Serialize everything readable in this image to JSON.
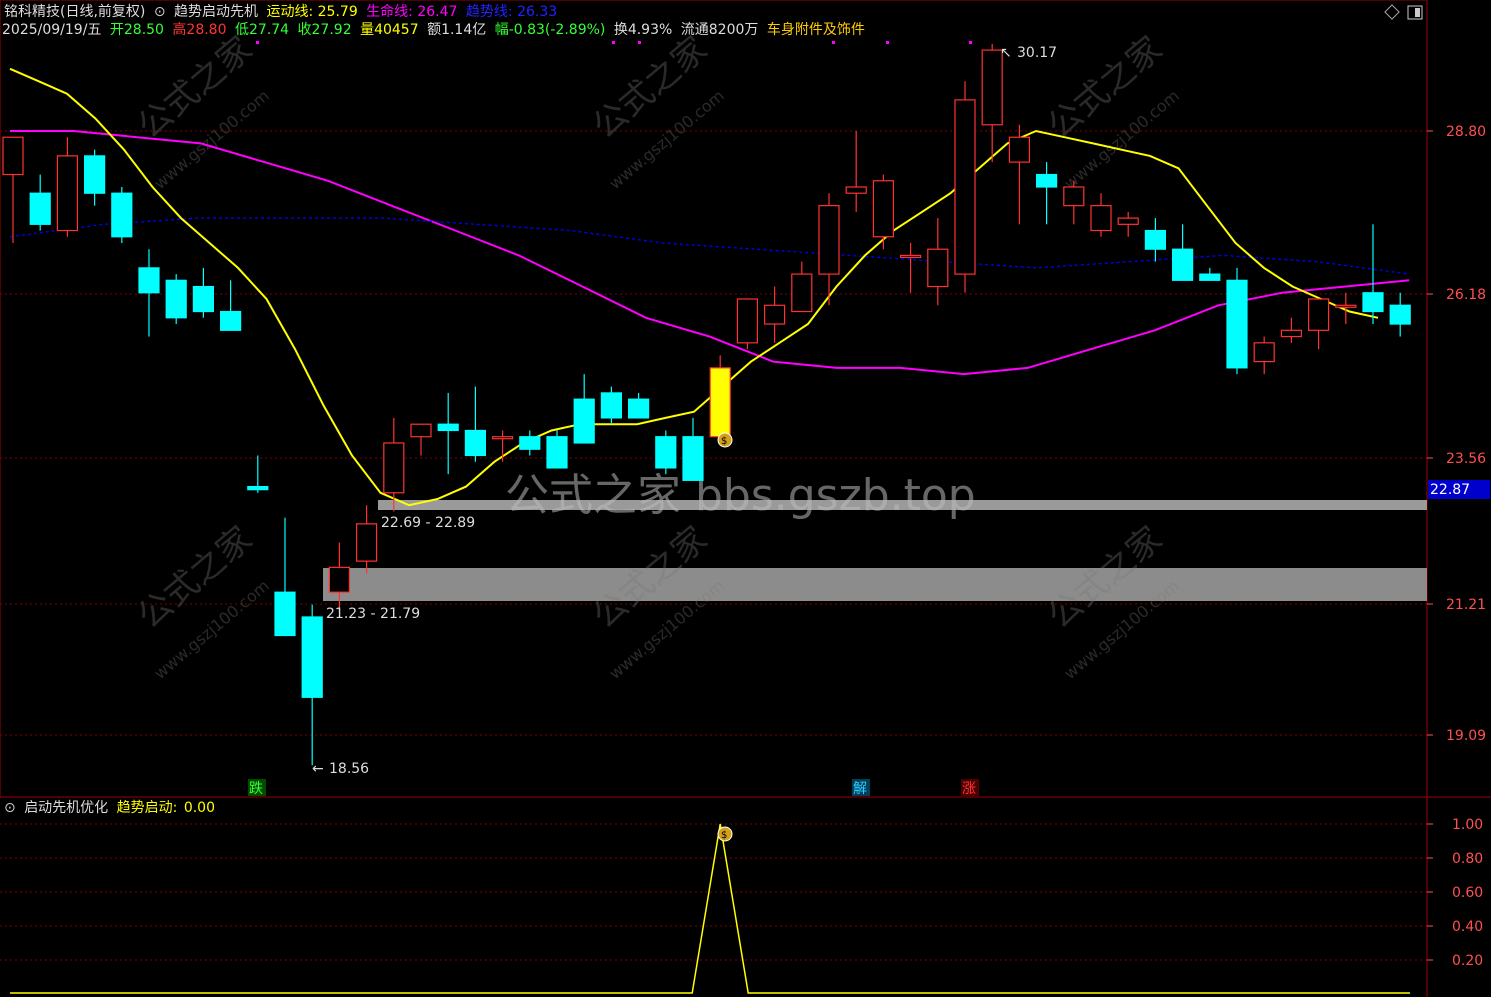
{
  "header": {
    "stock_title": "铭科精技(日线,前复权)",
    "indicator_name": "趋势启动先机",
    "yundong_label": "运动线:",
    "yundong_value": "25.79",
    "shengming_label": "生命线:",
    "shengming_value": "26.47",
    "qushi_label": "趋势线:",
    "qushi_value": "26.33",
    "date": "2025/09/19/五",
    "open_label": "开",
    "open_value": "28.50",
    "high_label": "高",
    "high_value": "28.80",
    "low_label": "低",
    "low_value": "27.74",
    "close_label": "收",
    "close_value": "27.92",
    "volume_label": "量",
    "volume_value": "40457",
    "amount_label": "额",
    "amount_value": "1.14亿",
    "change_label": "幅",
    "change_value": "-0.83(-2.89%)",
    "turnover_label": "换",
    "turnover_value": "4.93%",
    "float_label": "流通",
    "float_value": "8200万",
    "sector": "车身附件及饰件"
  },
  "price_axis": [
    "28.80",
    "26.18",
    "23.56",
    "21.21",
    "19.09"
  ],
  "current_price_tag": "22.87",
  "annotations": {
    "high_marker": "30.17",
    "low_marker": "18.56",
    "zone_upper_label": "22.69 - 22.89",
    "zone_lower_label": "21.23 - 21.79",
    "signal_die": "跌",
    "signal_jie": "解",
    "signal_zhang": "涨",
    "watermark_main": "公式之家 bbs.gszb.top",
    "watermark_small": "公式之家",
    "watermark_url": "www.gszj100.com"
  },
  "sub_panel": {
    "name": "启动先机优化",
    "signal_label": "趋势启动:",
    "signal_value": "0.00",
    "axis": [
      "1.00",
      "0.80",
      "0.60",
      "0.40",
      "0.20"
    ]
  },
  "colors": {
    "bg": "#000000",
    "up": "#ff3232",
    "down": "#00ffff",
    "yundong": "#ffff00",
    "shengming": "#ff00ff",
    "qushi": "#0000ff",
    "grid": "#800000",
    "axis_text": "#ff5050"
  },
  "chart_data": {
    "type": "candlestick",
    "candles": [
      {
        "o": 28.1,
        "h": 28.3,
        "l": 27.0,
        "c": 28.7
      },
      {
        "o": 27.8,
        "h": 28.1,
        "l": 27.2,
        "c": 27.3
      },
      {
        "o": 27.2,
        "h": 28.7,
        "l": 27.1,
        "c": 28.4
      },
      {
        "o": 28.4,
        "h": 28.5,
        "l": 27.6,
        "c": 27.8
      },
      {
        "o": 27.8,
        "h": 27.9,
        "l": 27.0,
        "c": 27.1
      },
      {
        "o": 26.6,
        "h": 26.9,
        "l": 25.5,
        "c": 26.2
      },
      {
        "o": 26.4,
        "h": 26.5,
        "l": 25.7,
        "c": 25.8
      },
      {
        "o": 26.3,
        "h": 26.6,
        "l": 25.8,
        "c": 25.9
      },
      {
        "o": 25.9,
        "h": 26.4,
        "l": 25.6,
        "c": 25.6
      },
      {
        "o": 23.1,
        "h": 23.6,
        "l": 23.0,
        "c": 23.05
      },
      {
        "o": 21.4,
        "h": 22.6,
        "l": 20.8,
        "c": 20.7
      },
      {
        "o": 21.0,
        "h": 21.2,
        "l": 18.6,
        "c": 19.7
      },
      {
        "o": 21.4,
        "h": 22.2,
        "l": 21.1,
        "c": 21.8
      },
      {
        "o": 21.9,
        "h": 22.8,
        "l": 21.7,
        "c": 22.5
      },
      {
        "o": 23.0,
        "h": 24.2,
        "l": 22.7,
        "c": 23.8
      },
      {
        "o": 23.9,
        "h": 24.1,
        "l": 23.6,
        "c": 24.1
      },
      {
        "o": 24.1,
        "h": 24.6,
        "l": 23.3,
        "c": 24.0
      },
      {
        "o": 24.0,
        "h": 24.7,
        "l": 23.5,
        "c": 23.6
      },
      {
        "o": 23.9,
        "h": 24.0,
        "l": 23.5,
        "c": 23.9
      },
      {
        "o": 23.9,
        "h": 24.0,
        "l": 23.6,
        "c": 23.7
      },
      {
        "o": 23.9,
        "h": 24.0,
        "l": 23.5,
        "c": 23.4
      },
      {
        "o": 24.5,
        "h": 24.9,
        "l": 23.8,
        "c": 23.8
      },
      {
        "o": 24.6,
        "h": 24.7,
        "l": 24.1,
        "c": 24.2
      },
      {
        "o": 24.5,
        "h": 24.6,
        "l": 24.2,
        "c": 24.2
      },
      {
        "o": 23.9,
        "h": 24.0,
        "l": 23.3,
        "c": 23.4
      },
      {
        "o": 23.9,
        "h": 24.2,
        "l": 23.2,
        "c": 23.2
      },
      {
        "o": 23.9,
        "h": 25.2,
        "l": 23.8,
        "c": 25.0
      },
      {
        "o": 25.4,
        "h": 26.1,
        "l": 25.3,
        "c": 26.1
      },
      {
        "o": 25.7,
        "h": 26.3,
        "l": 25.4,
        "c": 26.0
      },
      {
        "o": 25.9,
        "h": 26.7,
        "l": 25.9,
        "c": 26.5
      },
      {
        "o": 26.5,
        "h": 27.8,
        "l": 26.0,
        "c": 27.6
      },
      {
        "o": 27.8,
        "h": 28.8,
        "l": 27.5,
        "c": 27.9
      },
      {
        "o": 27.1,
        "h": 28.1,
        "l": 26.9,
        "c": 28.0
      },
      {
        "o": 26.8,
        "h": 27.0,
        "l": 26.2,
        "c": 26.8
      },
      {
        "o": 26.3,
        "h": 27.4,
        "l": 26.0,
        "c": 26.9
      },
      {
        "o": 26.5,
        "h": 29.6,
        "l": 26.2,
        "c": 29.3
      },
      {
        "o": 28.9,
        "h": 30.2,
        "l": 28.3,
        "c": 30.1
      },
      {
        "o": 28.3,
        "h": 28.9,
        "l": 27.3,
        "c": 28.7
      },
      {
        "o": 28.1,
        "h": 28.3,
        "l": 27.3,
        "c": 27.9
      },
      {
        "o": 27.6,
        "h": 28.0,
        "l": 27.3,
        "c": 27.9
      },
      {
        "o": 27.2,
        "h": 27.8,
        "l": 27.1,
        "c": 27.6
      },
      {
        "o": 27.3,
        "h": 27.5,
        "l": 27.1,
        "c": 27.4
      },
      {
        "o": 27.2,
        "h": 27.4,
        "l": 26.7,
        "c": 26.9
      },
      {
        "o": 26.9,
        "h": 27.3,
        "l": 26.7,
        "c": 26.4
      },
      {
        "o": 26.5,
        "h": 26.6,
        "l": 26.5,
        "c": 26.4
      },
      {
        "o": 26.4,
        "h": 26.6,
        "l": 24.9,
        "c": 25.0
      },
      {
        "o": 25.1,
        "h": 25.5,
        "l": 24.9,
        "c": 25.4
      },
      {
        "o": 25.5,
        "h": 25.8,
        "l": 25.4,
        "c": 25.6
      },
      {
        "o": 25.6,
        "h": 26.1,
        "l": 25.3,
        "c": 26.1
      },
      {
        "o": 26.0,
        "h": 26.2,
        "l": 25.7,
        "c": 26.0
      },
      {
        "o": 26.2,
        "h": 27.3,
        "l": 25.7,
        "c": 25.9
      },
      {
        "o": 26.0,
        "h": 26.2,
        "l": 25.5,
        "c": 25.7
      }
    ],
    "yundong_line": [
      29.8,
      29.6,
      29.4,
      29.0,
      28.5,
      27.9,
      27.4,
      27.0,
      26.6,
      26.1,
      25.3,
      24.4,
      23.6,
      23.0,
      22.8,
      22.9,
      23.1,
      23.5,
      23.8,
      24.0,
      24.1,
      24.1,
      24.1,
      24.2,
      24.3,
      24.7,
      25.1,
      25.4,
      25.7,
      26.3,
      26.8,
      27.2,
      27.5,
      27.8,
      28.2,
      28.6,
      28.8,
      28.7,
      28.6,
      28.5,
      28.4,
      28.2,
      27.6,
      27.0,
      26.6,
      26.3,
      26.1,
      25.9,
      25.8
    ],
    "shengming_line": [
      28.8,
      28.8,
      28.7,
      28.6,
      28.3,
      28.0,
      27.6,
      27.2,
      26.8,
      26.3,
      25.8,
      25.5,
      25.1,
      25.0,
      25.0,
      24.9,
      25.0,
      25.3,
      25.6,
      26.0,
      26.2,
      26.3,
      26.4
    ],
    "qushi_line": [
      27.1,
      27.3,
      27.4,
      27.4,
      27.4,
      27.3,
      27.2,
      27.0,
      26.9,
      26.8,
      26.7,
      26.6,
      26.7,
      26.8,
      26.7,
      26.5
    ],
    "sub_signal": {
      "peak_index": 26,
      "peak_value": 1.0
    },
    "ylim": [
      18.2,
      31.2
    ]
  }
}
